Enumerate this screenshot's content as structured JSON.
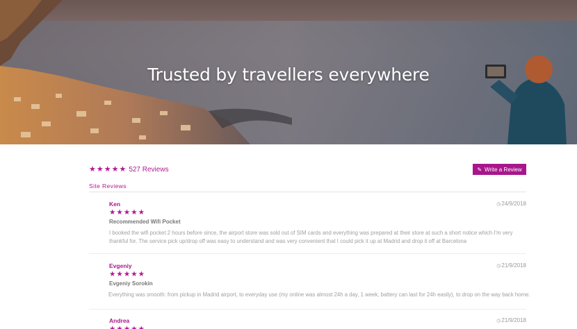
{
  "hero": {
    "title": "Trusted by travellers everywhere"
  },
  "summary": {
    "stars": "★★★★★",
    "count_label": "527 Reviews"
  },
  "write_review": {
    "label": "Write a Review",
    "icon": "edit-icon"
  },
  "section": {
    "title": "Site Reviews"
  },
  "colors": {
    "accent": "#a8168c",
    "muted_text": "#a0a0a0",
    "divider": "#e3e3e3"
  },
  "reviews": [
    {
      "name": "Ken",
      "date": "24/9/2018",
      "stars": "★★★★★",
      "rating": 5,
      "title": "Recommended Wifi Pocket",
      "body": "I booked the wifi pocket 2 hours before since, the airport store was sold out of SIM cards and everything was prepared at their store at such a short notice which I'm very thankful for. The service pick up/drop off was easy to understand and was very convenient that I could pick it up at Madrid and drop it off at Barcelona"
    },
    {
      "name": "Evgeniy",
      "date": "21/9/2018",
      "stars": "★★★★★",
      "rating": 5,
      "title": "Evgeniy Sorokin",
      "body": "Everything was smooth: from pickup in Madrid airport, to everyday use (my online was almost 24h a day, 1 week, battery can last for 24h easily), to drop on the way back home."
    },
    {
      "name": "Andrea",
      "date": "21/9/2018",
      "stars": "★★★★★",
      "rating": 5,
      "title": "",
      "body": ""
    }
  ]
}
